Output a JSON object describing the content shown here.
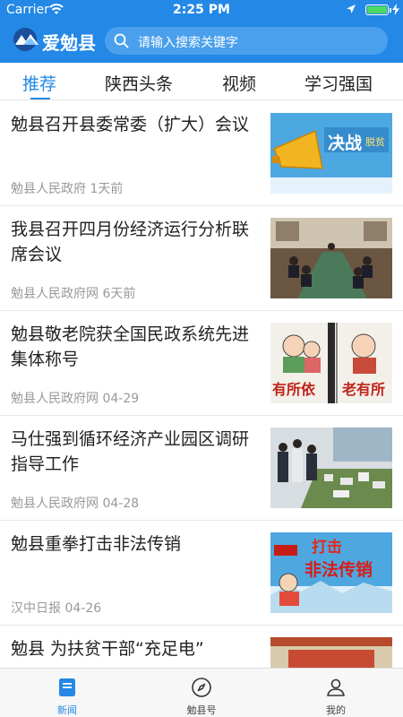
{
  "status_bar": {
    "carrier": "Carrier",
    "time": "2:25 PM"
  },
  "header": {
    "app_name": "爱勉县",
    "search_placeholder": "请输入搜索关键字"
  },
  "tabs": [
    {
      "label": "推荐",
      "active": true
    },
    {
      "label": "陕西头条",
      "active": false
    },
    {
      "label": "视频",
      "active": false
    },
    {
      "label": "学习强国",
      "active": false
    }
  ],
  "feed": [
    {
      "title": "勉县召开县委常委（扩大）会议",
      "source": "勉县人民政府",
      "time": "1天前",
      "thumb": {
        "kind": "banner",
        "text": "决战",
        "text2": "脱贫"
      }
    },
    {
      "title": "我县召开四月份经济运行分析联席会议",
      "source": "勉县人民政府网",
      "time": "6天前",
      "thumb": {
        "kind": "meeting"
      }
    },
    {
      "title": "勉县敬老院获全国民政系统先进集体称号",
      "source": "勉县人民政府网",
      "time": "04-29",
      "thumb": {
        "kind": "poster",
        "text_left": "有所依",
        "text_right": "老有所"
      }
    },
    {
      "title": "马仕强到循环经济产业园区调研指导工作",
      "source": "勉县人民政府网",
      "time": "04-28",
      "thumb": {
        "kind": "model"
      }
    },
    {
      "title": "勉县重拳打击非法传销",
      "source": "汉中日报",
      "time": "04-26",
      "thumb": {
        "kind": "campaign",
        "text": "打击",
        "text2": "非法传销"
      }
    },
    {
      "title": "勉县 为扶贫干部“充足电”",
      "source": "",
      "time": "",
      "thumb": {
        "kind": "hall"
      }
    }
  ],
  "tabbar": [
    {
      "label": "新闻",
      "icon": "news-icon",
      "active": true
    },
    {
      "label": "勉县号",
      "icon": "compass-icon",
      "active": false
    },
    {
      "label": "我的",
      "icon": "person-icon",
      "active": false
    }
  ],
  "colors": {
    "primary": "#2388e6",
    "search_bg": "#4aa0ec",
    "meta_text": "#999999",
    "battery": "#4cd964"
  }
}
